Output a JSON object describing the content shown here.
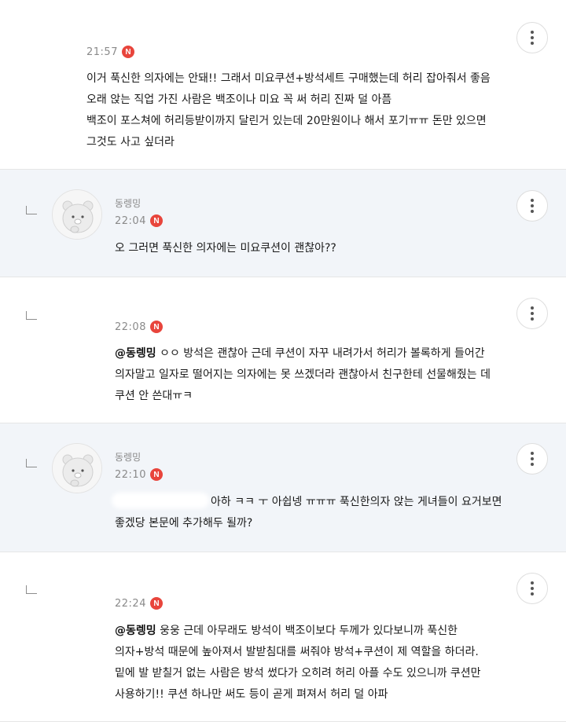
{
  "comments": [
    {
      "author": "",
      "time": "21:57",
      "badge": "N",
      "lines": [
        "이거 푹신한 의자에는 안돼!! 그래서 미요쿠션+방석세트 구매했는데 허리 잡아줘서 좋음",
        "오래 앉는 직업 가진 사람은 백조이나 미요 꼭 써 허리 진짜 덜 아픔",
        "백조이 포스쳐에 허리등받이까지 달린거 있는데 20만원이나 해서 포기ㅠㅠ 돈만 있으면",
        "그것도 사고 싶더라"
      ]
    },
    {
      "author": "동렝밍",
      "time": "22:04",
      "badge": "N",
      "lines": [
        "오 그러면 푹신한 의자에는 미요쿠션이 괜찮아??"
      ]
    },
    {
      "author": "",
      "time": "22:08",
      "badge": "N",
      "mention": "@동렝밍",
      "lines": [
        " ㅇㅇ 방석은 괜찮아 근데 쿠션이 자꾸 내려가서 허리가 볼록하게 들어간",
        "의자말고 일자로 떨어지는 의자에는 못 쓰겠더라 괜찮아서 친구한테 선물해줬는 데",
        "쿠션 안 쓴대ㅠㅋ"
      ]
    },
    {
      "author": "동렝밍",
      "time": "22:10",
      "badge": "N",
      "lines": [
        "아하 ㅋㅋ ㅜ 아쉽넹 ㅠㅠㅠ 푹신한의자 앉는 게녀들이 요거보면",
        "좋겠당 본문에 추가해두 될까?"
      ]
    },
    {
      "author": "",
      "time": "22:24",
      "badge": "N",
      "mention": "@동렝밍",
      "lines": [
        " 웅웅 근데 아무래도 방석이 백조이보다 두께가 있다보니까 푹신한",
        "의자+방석 때문에 높아져서 발받침대를 써줘야 방석+쿠션이 제 역할을 하더라.",
        "밑에 발 받칠거 없는 사람은 방석 썼다가 오히려 허리 아플 수도 있으니까 쿠션만",
        "사용하기!! 쿠션 하나만 써도 등이 곧게 펴져서 허리 덜 아파"
      ]
    }
  ],
  "icons": {
    "more": "more-vertical-icon",
    "reply": "reply-arrow-icon",
    "new": "new-badge"
  },
  "colors": {
    "badge": "#e8453c",
    "reply_bg": "#f2f5f9"
  }
}
